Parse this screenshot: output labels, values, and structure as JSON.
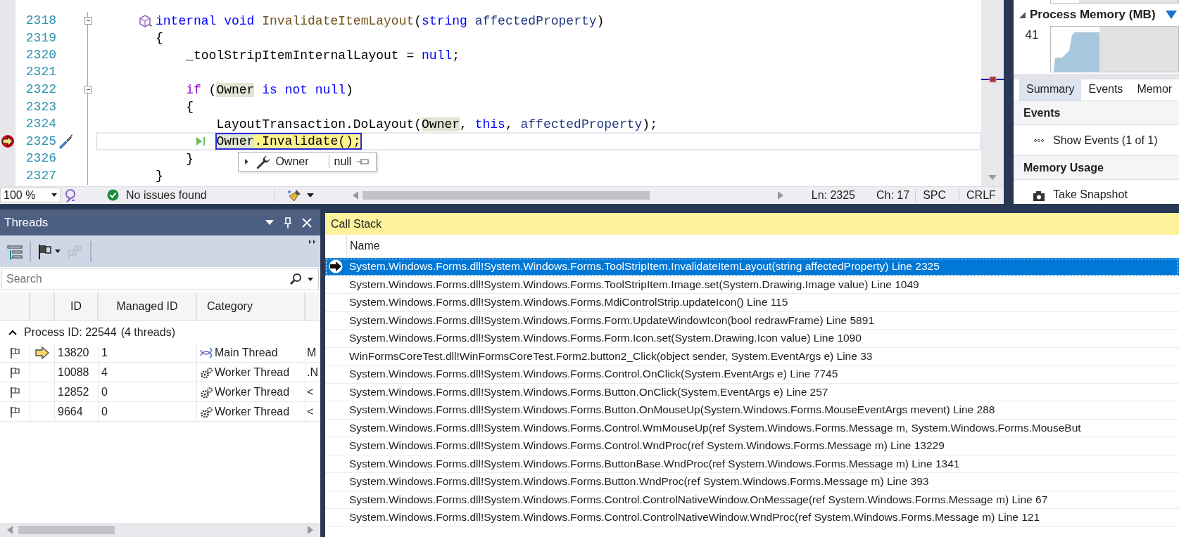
{
  "editor": {
    "lines": [
      {
        "number": "2318",
        "declaration": true,
        "current": false,
        "collapsible": true,
        "tokens": [
          {
            "text": "internal ",
            "kind": "keyword"
          },
          {
            "text": "void ",
            "kind": "keyword"
          },
          {
            "text": "InvalidateItemLayout",
            "kind": "method"
          },
          {
            "text": "(",
            "kind": "plain"
          },
          {
            "text": "string ",
            "kind": "keyword"
          },
          {
            "text": "affectedProperty",
            "kind": "param"
          },
          {
            "text": ")",
            "kind": "plain"
          }
        ]
      },
      {
        "number": "2319",
        "declaration": false,
        "current": false,
        "collapsible": false,
        "tokens": [
          {
            "text": "{",
            "kind": "plain"
          }
        ],
        "children": [
          {
            "number": "2320",
            "declaration": false,
            "current": false,
            "collapsible": false,
            "tokens": [
              {
                "text": "_toolStripItemInternalLayout = ",
                "kind": "plain"
              },
              {
                "text": "null",
                "kind": "keyword"
              },
              {
                "text": ";",
                "kind": "plain"
              }
            ]
          },
          {
            "number": "2321",
            "declaration": false,
            "current": false,
            "collapsible": false
          },
          {
            "number": "2322",
            "declaration": false,
            "current": false,
            "collapsible": true,
            "tokens": [
              {
                "text": "if",
                "kind": "control"
              },
              {
                "text": " (",
                "kind": "plain"
              },
              {
                "text": "Owner",
                "kind": "ref"
              },
              {
                "text": " is not null",
                "kind": "keyword"
              },
              {
                "text": ")",
                "kind": "plain"
              }
            ]
          },
          {
            "number": "2323",
            "declaration": false,
            "current": false,
            "collapsible": false,
            "tokens": [
              {
                "text": "{",
                "kind": "plain"
              }
            ],
            "children": [
              {
                "number": "2324",
                "declaration": false,
                "current": false,
                "collapsible": false,
                "tokens": [
                  {
                    "text": "LayoutTransaction.DoLayout(",
                    "kind": "plain"
                  },
                  {
                    "text": "Owner",
                    "kind": "ref"
                  },
                  {
                    "text": ", ",
                    "kind": "plain"
                  },
                  {
                    "text": "this",
                    "kind": "keyword"
                  },
                  {
                    "text": ", ",
                    "kind": "plain"
                  },
                  {
                    "text": "affectedProperty",
                    "kind": "param"
                  },
                  {
                    "text": ");",
                    "kind": "plain"
                  }
                ]
              },
              {
                "number": "2325",
                "declaration": false,
                "current": true,
                "collapsible": false,
                "tokens": [
                  {
                    "text": "Owner",
                    "kind": "ref"
                  },
                  {
                    "text": ".Invalidate();",
                    "kind": "plain"
                  }
                ]
              }
            ]
          },
          {
            "number": "2326",
            "declaration": false,
            "current": false,
            "collapsible": false,
            "tokens": [
              {
                "text": "}",
                "kind": "plain"
              }
            ]
          }
        ]
      },
      {
        "number": "2327",
        "declaration": false,
        "current": false,
        "collapsible": false,
        "tokens": [
          {
            "text": "}",
            "kind": "plain"
          }
        ]
      }
    ],
    "datatip": {
      "name": "Owner",
      "value": "null"
    },
    "status_bar": {
      "zoom": "100 %",
      "issues": "No issues found",
      "line": "Ln: 2325",
      "column": "Ch: 17",
      "indent_mode": "SPC",
      "line_ending": "CRLF"
    }
  },
  "diagnostics": {
    "section": "Process Memory (MB)",
    "axis_max": "41",
    "tabs": [
      {
        "label": "Summary",
        "selected": true
      },
      {
        "label": "Events",
        "selected": false
      },
      {
        "label": "Memor",
        "selected": false
      }
    ],
    "events_header": "Events",
    "show_events": "Show Events (1 of 1)",
    "memory_header": "Memory Usage",
    "snapshot": "Take Snapshot"
  },
  "threads": {
    "title": "Threads",
    "search": {
      "placeholder": "Search"
    },
    "columns": [
      "ID",
      "Managed ID",
      "Category"
    ],
    "group": {
      "label": "Process ID: 22544",
      "count": "(4 threads)",
      "expanded": true
    },
    "rows": [
      {
        "current": true,
        "id": "13820",
        "managed_id": "1",
        "kind": "main",
        "category": "Main Thread",
        "column_5": "M"
      },
      {
        "current": false,
        "id": "10088",
        "managed_id": "4",
        "kind": "worker",
        "category": "Worker Thread",
        "column_5": ".N"
      },
      {
        "current": false,
        "id": "12852",
        "managed_id": "0",
        "kind": "worker",
        "category": "Worker Thread",
        "column_5": "<"
      },
      {
        "current": false,
        "id": "9664",
        "managed_id": "0",
        "kind": "worker",
        "category": "Worker Thread",
        "column_5": "<"
      }
    ]
  },
  "call_stack": {
    "title": "Call Stack",
    "columns": [
      "Name"
    ],
    "frames": [
      {
        "selected": true,
        "current": true,
        "text": "System.Windows.Forms.dll!System.Windows.Forms.ToolStripItem.InvalidateItemLayout(string affectedProperty) Line 2325"
      },
      {
        "selected": false,
        "current": false,
        "text": "System.Windows.Forms.dll!System.Windows.Forms.ToolStripItem.Image.set(System.Drawing.Image value) Line 1049"
      },
      {
        "selected": false,
        "current": false,
        "text": "System.Windows.Forms.dll!System.Windows.Forms.MdiControlStrip.updateIcon() Line 115"
      },
      {
        "selected": false,
        "current": false,
        "text": "System.Windows.Forms.dll!System.Windows.Forms.Form.UpdateWindowIcon(bool redrawFrame) Line 5891"
      },
      {
        "selected": false,
        "current": false,
        "text": "System.Windows.Forms.dll!System.Windows.Forms.Form.Icon.set(System.Drawing.Icon value) Line 1090"
      },
      {
        "selected": false,
        "current": false,
        "text": "WinFormsCoreTest.dll!WinFormsCoreTest.Form2.button2_Click(object sender, System.EventArgs e) Line 33"
      },
      {
        "selected": false,
        "current": false,
        "text": "System.Windows.Forms.dll!System.Windows.Forms.Control.OnClick(System.EventArgs e) Line 7745"
      },
      {
        "selected": false,
        "current": false,
        "text": "System.Windows.Forms.dll!System.Windows.Forms.Button.OnClick(System.EventArgs e) Line 257"
      },
      {
        "selected": false,
        "current": false,
        "text": "System.Windows.Forms.dll!System.Windows.Forms.Button.OnMouseUp(System.Windows.Forms.MouseEventArgs mevent) Line 288"
      },
      {
        "selected": false,
        "current": false,
        "text": "System.Windows.Forms.dll!System.Windows.Forms.Control.WmMouseUp(ref System.Windows.Forms.Message m, System.Windows.Forms.MouseBut"
      },
      {
        "selected": false,
        "current": false,
        "text": "System.Windows.Forms.dll!System.Windows.Forms.Control.WndProc(ref System.Windows.Forms.Message m) Line 13229"
      },
      {
        "selected": false,
        "current": false,
        "text": "System.Windows.Forms.dll!System.Windows.Forms.ButtonBase.WndProc(ref System.Windows.Forms.Message m) Line 1341"
      },
      {
        "selected": false,
        "current": false,
        "text": "System.Windows.Forms.dll!System.Windows.Forms.Button.WndProc(ref System.Windows.Forms.Message m) Line 393"
      },
      {
        "selected": false,
        "current": false,
        "text": "System.Windows.Forms.dll!System.Windows.Forms.Control.ControlNativeWindow.OnMessage(ref System.Windows.Forms.Message m) Line 67"
      },
      {
        "selected": false,
        "current": false,
        "text": "System.Windows.Forms.dll!System.Windows.Forms.Control.ControlNativeWindow.WndProc(ref System.Windows.Forms.Message m) Line 121"
      }
    ]
  }
}
